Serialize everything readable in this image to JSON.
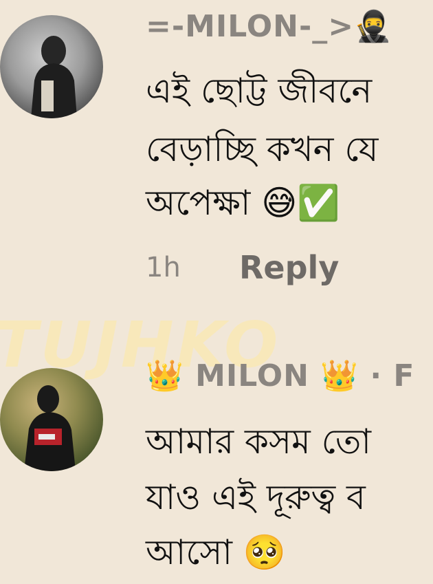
{
  "comments": [
    {
      "author": "=-MILON-_>🥷",
      "body_lines": [
        "এই ছোট্ট জীবনে",
        "বেড়াচ্ছি কখন যে",
        "অপেক্ষা 😅✅"
      ],
      "time": "1h",
      "reply_label": "Reply"
    },
    {
      "author": "👑 MILON 👑 · F",
      "body_lines": [
        "আমার কসম তো",
        "যাও এই দূরুত্ব ব",
        "আসো 🥺"
      ]
    }
  ],
  "overlay": {
    "text": "TUJHKO"
  }
}
